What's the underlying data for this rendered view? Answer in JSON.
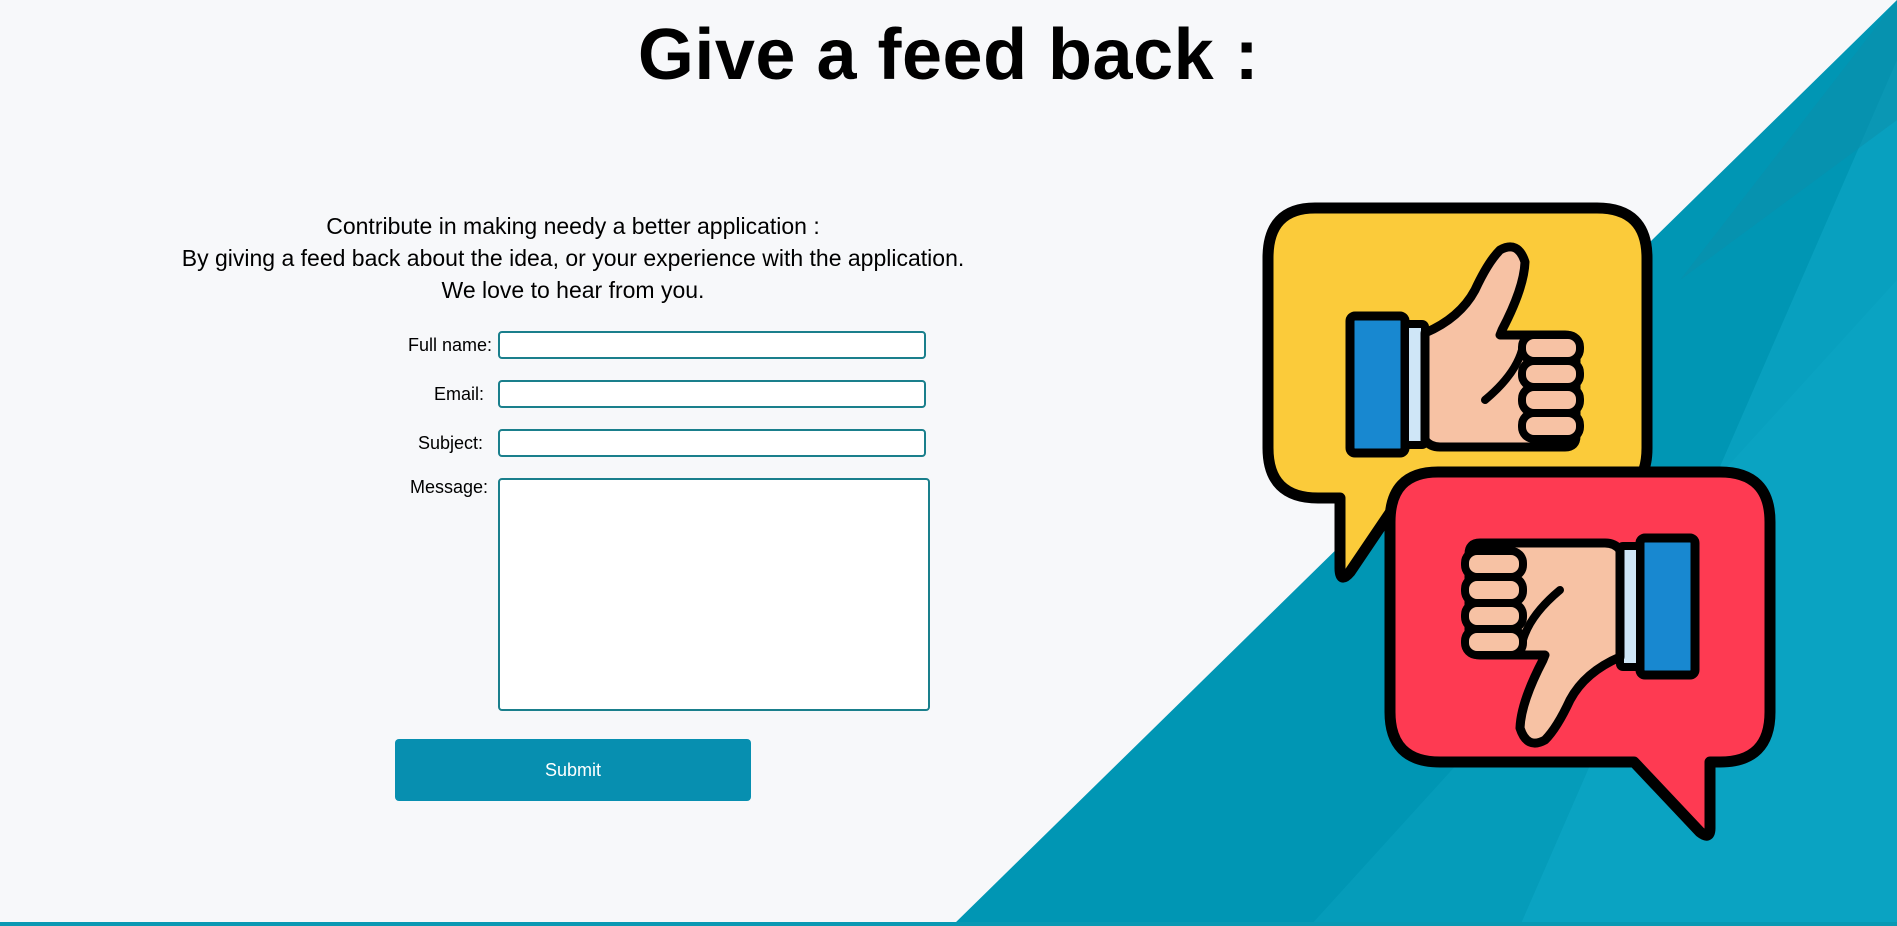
{
  "page": {
    "title": "Give a feed back :"
  },
  "intro": {
    "line1": "Contribute in making needy a better application :",
    "line2": "By giving a feed back about the idea, or your experience with the application.",
    "line3": "We love to hear from you."
  },
  "form": {
    "fullname_label": "Full name:",
    "fullname_value": "",
    "email_label": "Email:",
    "email_value": "",
    "subject_label": "Subject:",
    "subject_value": "",
    "message_label": "Message:",
    "message_value": "",
    "submit_label": "Submit"
  },
  "illustration": {
    "thumbs_up_icon": "thumbs-up-icon",
    "thumbs_down_icon": "thumbs-down-icon"
  },
  "colors": {
    "background": "#f7f8fa",
    "accent_teal": "#078fb0",
    "input_border": "#1a7f8c",
    "bubble_yellow": "#fbcb3a",
    "bubble_red": "#fe3a52",
    "cuff_blue": "#1888d0",
    "skin": "#f7c2a4"
  }
}
